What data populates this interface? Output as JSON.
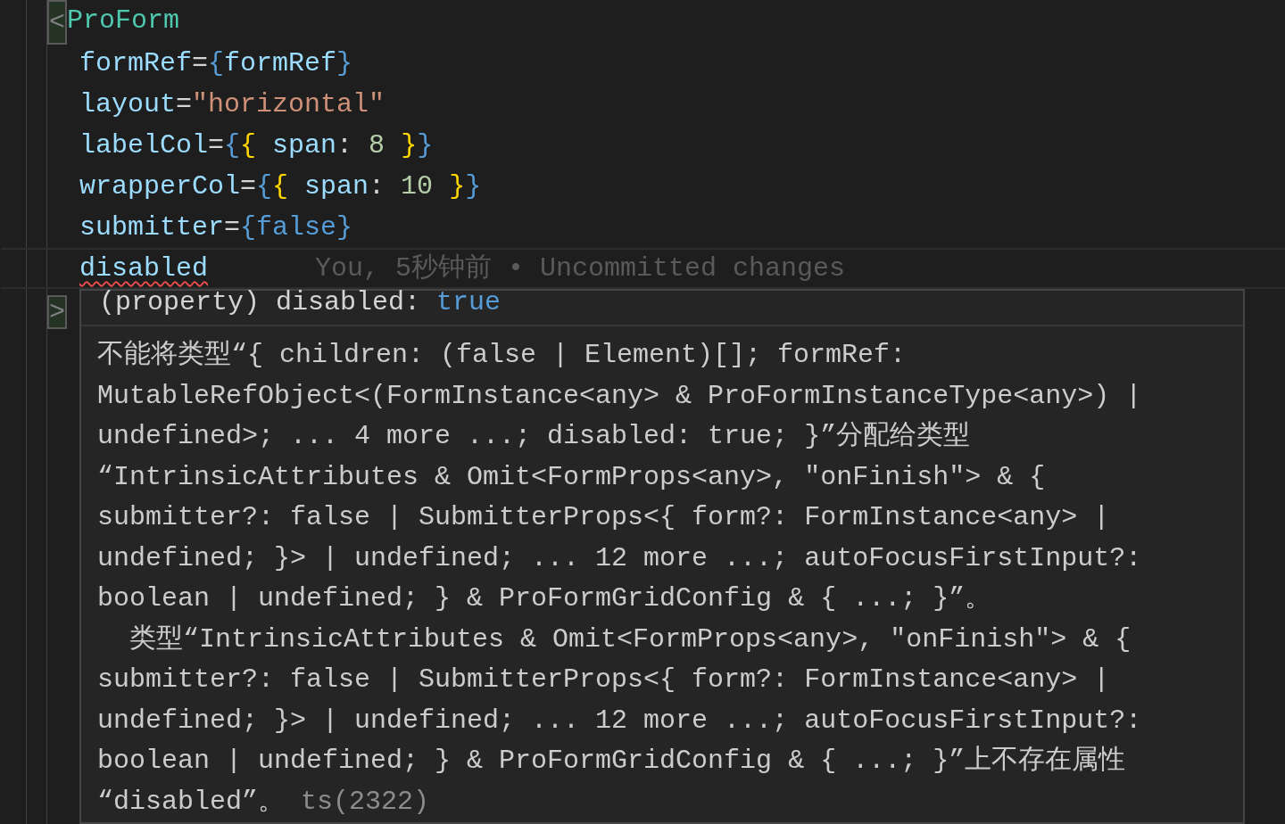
{
  "editor": {
    "lines": [
      {
        "tokens": [
          {
            "kind": "bracket",
            "text": "<"
          },
          {
            "kind": "tag",
            "text": "ProForm"
          }
        ]
      },
      {
        "indent": true,
        "tokens": [
          {
            "kind": "attr",
            "text": "formRef"
          },
          {
            "kind": "op",
            "text": "="
          },
          {
            "kind": "brace",
            "text": "{"
          },
          {
            "kind": "var",
            "text": "formRef"
          },
          {
            "kind": "brace",
            "text": "}"
          }
        ]
      },
      {
        "indent": true,
        "tokens": [
          {
            "kind": "attr",
            "text": "layout"
          },
          {
            "kind": "op",
            "text": "="
          },
          {
            "kind": "string",
            "text": "\"horizontal\""
          }
        ]
      },
      {
        "indent": true,
        "tokens": [
          {
            "kind": "attr",
            "text": "labelCol"
          },
          {
            "kind": "op",
            "text": "="
          },
          {
            "kind": "brace",
            "text": "{"
          },
          {
            "kind": "brace2",
            "text": "{ "
          },
          {
            "kind": "var",
            "text": "span"
          },
          {
            "kind": "op",
            "text": ": "
          },
          {
            "kind": "number",
            "text": "8 "
          },
          {
            "kind": "brace2",
            "text": "}"
          },
          {
            "kind": "brace",
            "text": "}"
          }
        ]
      },
      {
        "indent": true,
        "tokens": [
          {
            "kind": "attr",
            "text": "wrapperCol"
          },
          {
            "kind": "op",
            "text": "="
          },
          {
            "kind": "brace",
            "text": "{"
          },
          {
            "kind": "brace2",
            "text": "{ "
          },
          {
            "kind": "var",
            "text": "span"
          },
          {
            "kind": "op",
            "text": ": "
          },
          {
            "kind": "number",
            "text": "10 "
          },
          {
            "kind": "brace2",
            "text": "}"
          },
          {
            "kind": "brace",
            "text": "}"
          }
        ]
      },
      {
        "indent": true,
        "tokens": [
          {
            "kind": "attr",
            "text": "submitter"
          },
          {
            "kind": "op",
            "text": "="
          },
          {
            "kind": "brace",
            "text": "{"
          },
          {
            "kind": "keyword",
            "text": "false"
          },
          {
            "kind": "brace",
            "text": "}"
          }
        ]
      },
      {
        "indent": true,
        "tokens": [
          {
            "kind": "attr",
            "text": "disabled"
          }
        ],
        "current": true,
        "error": true,
        "blame": "You, 5秒钟前 • Uncommitted changes"
      }
    ],
    "closing_bracket": ">",
    "hover": {
      "signature": [
        {
          "kind": "plain",
          "text": "(property) disabled: "
        },
        {
          "kind": "keyword",
          "text": "true"
        }
      ],
      "message": [
        "不能将类型“{ children: (false | Element)[]; formRef:",
        "MutableRefObject<(FormInstance<any> & ProFormInstanceType<any>) |",
        "undefined>; ... 4 more ...; disabled: true; }”分配给类型",
        "“IntrinsicAttributes & Omit<FormProps<any>, \"onFinish\"> & {",
        "submitter?: false | SubmitterProps<{ form?: FormInstance<any> |",
        "undefined; }> | undefined; ... 12 more ...; autoFocusFirstInput?:",
        "boolean | undefined; } & ProFormGridConfig & { ...; }”。",
        "  类型“IntrinsicAttributes & Omit<FormProps<any>, \"onFinish\"> & {",
        "submitter?: false | SubmitterProps<{ form?: FormInstance<any> |",
        "undefined; }> | undefined; ... 12 more ...; autoFocusFirstInput?:",
        "boolean | undefined; } & ProFormGridConfig & { ...; }”上不存在属性",
        "“disabled”。"
      ],
      "code": "ts(2322)"
    }
  }
}
